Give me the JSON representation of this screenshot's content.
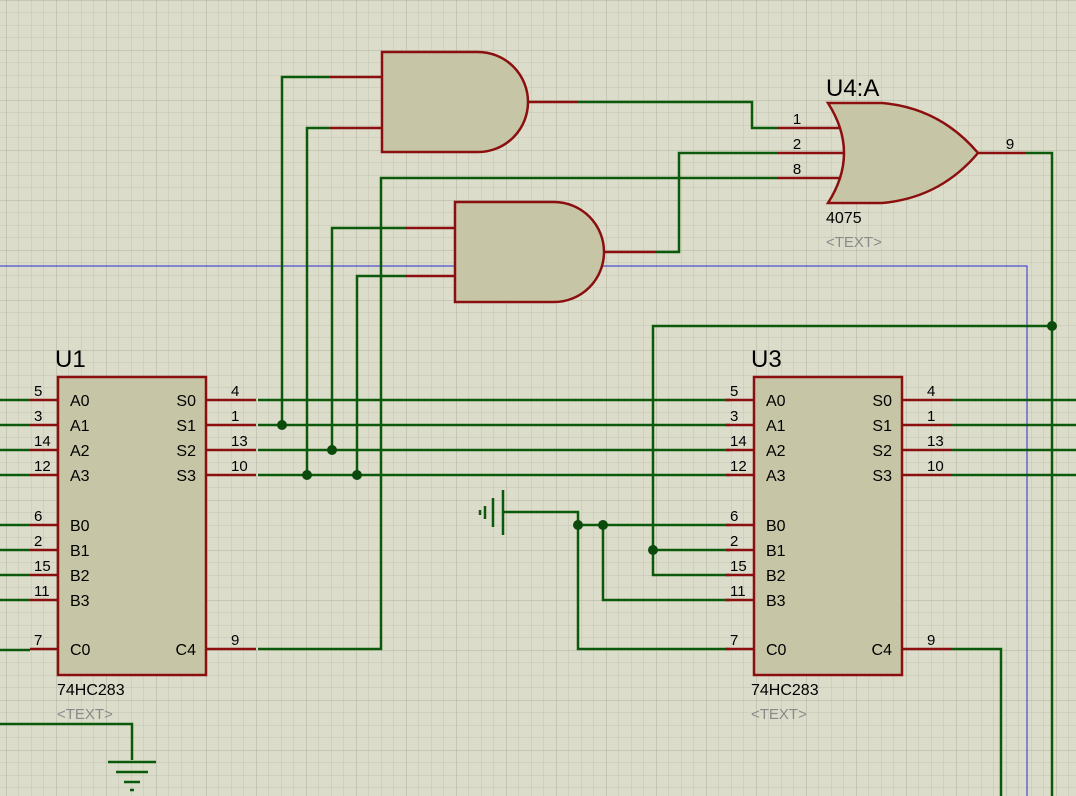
{
  "colors": {
    "background": "#dcdccb",
    "grid_minor": "#c5c5b3",
    "grid_major": "#b2b2a0",
    "wire": "#0b5a0b",
    "pin": "#8b0f0f",
    "body_fill": "#c6c6a6",
    "body_stroke": "#8b0f0f",
    "junction": "#0b4a0b",
    "bus_line": "#2a2ad0",
    "label": "#000000",
    "placeholder_text": "#8a8a8a"
  },
  "u1": {
    "ref": "U1",
    "part": "74HC283",
    "text": "<TEXT>",
    "left_pins": [
      {
        "num": "5",
        "name": "A0"
      },
      {
        "num": "3",
        "name": "A1"
      },
      {
        "num": "14",
        "name": "A2"
      },
      {
        "num": "12",
        "name": "A3"
      },
      {
        "num": "6",
        "name": "B0"
      },
      {
        "num": "2",
        "name": "B1"
      },
      {
        "num": "15",
        "name": "B2"
      },
      {
        "num": "11",
        "name": "B3"
      },
      {
        "num": "7",
        "name": "C0"
      }
    ],
    "right_pins": [
      {
        "num": "4",
        "name": "S0"
      },
      {
        "num": "1",
        "name": "S1"
      },
      {
        "num": "13",
        "name": "S2"
      },
      {
        "num": "10",
        "name": "S3"
      },
      {
        "num": "9",
        "name": "C4"
      }
    ]
  },
  "u3": {
    "ref": "U3",
    "part": "74HC283",
    "text": "<TEXT>",
    "left_pins": [
      {
        "num": "5",
        "name": "A0"
      },
      {
        "num": "3",
        "name": "A1"
      },
      {
        "num": "14",
        "name": "A2"
      },
      {
        "num": "12",
        "name": "A3"
      },
      {
        "num": "6",
        "name": "B0"
      },
      {
        "num": "2",
        "name": "B1"
      },
      {
        "num": "15",
        "name": "B2"
      },
      {
        "num": "11",
        "name": "B3"
      },
      {
        "num": "7",
        "name": "C0"
      }
    ],
    "right_pins": [
      {
        "num": "4",
        "name": "S0"
      },
      {
        "num": "1",
        "name": "S1"
      },
      {
        "num": "13",
        "name": "S2"
      },
      {
        "num": "10",
        "name": "S3"
      },
      {
        "num": "9",
        "name": "C4"
      }
    ]
  },
  "u4a": {
    "ref": "U4:A",
    "part": "4075",
    "text": "<TEXT>",
    "pins": [
      "1",
      "2",
      "8",
      "9"
    ]
  }
}
